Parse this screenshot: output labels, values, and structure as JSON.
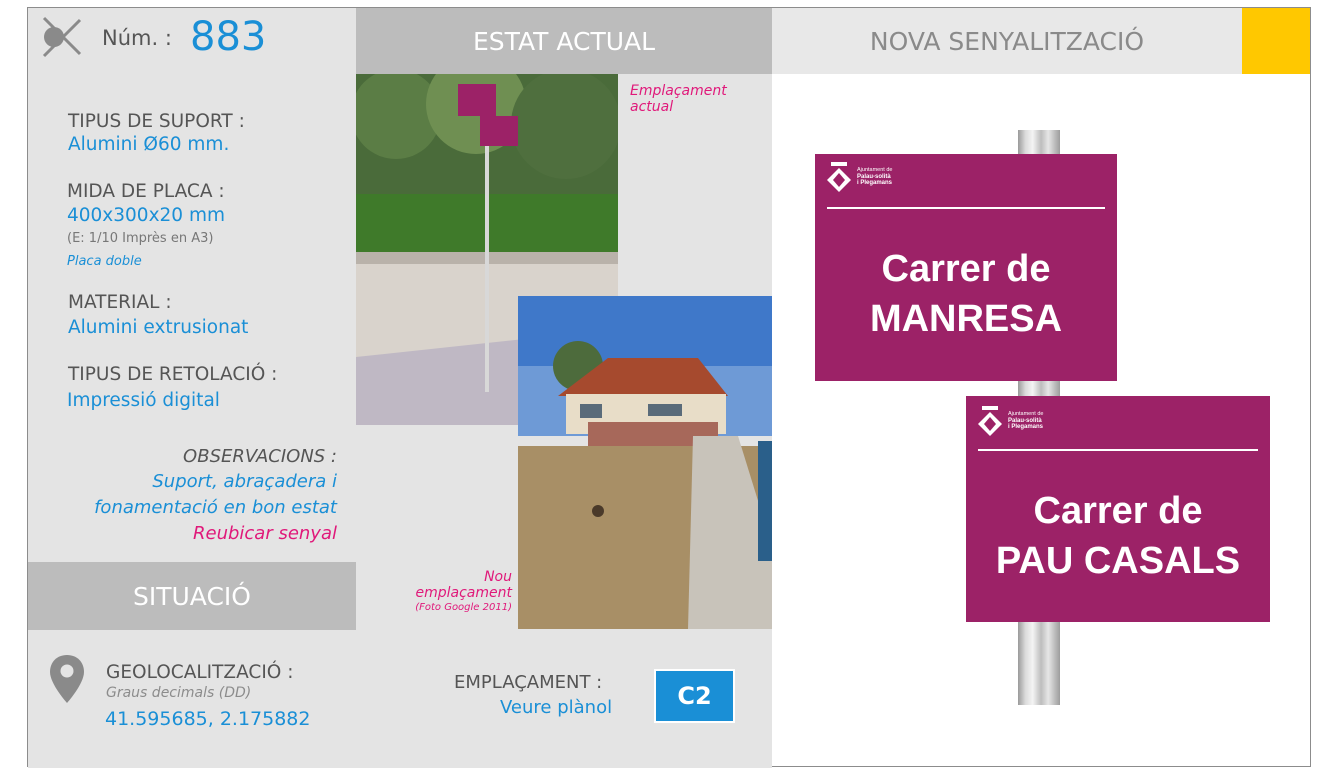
{
  "header": {
    "num_label": "Núm. :",
    "num_value": "883",
    "current_state": "ESTAT ACTUAL",
    "new_signage": "NOVA SENYALITZACIÓ",
    "accent_color": "#ffc800"
  },
  "specs": {
    "support_label": "TIPUS DE SUPORT :",
    "support_value": "Alumini Ø60 mm.",
    "size_label": "MIDA DE PLACA :",
    "size_value": "400x300x20 mm",
    "size_scale": "(E: 1/10 Imprès en A3)",
    "size_type": "Placa doble",
    "material_label": "MATERIAL :",
    "material_value": "Alumini extrusionat",
    "lettering_label": "TIPUS DE RETOLACIÓ :",
    "lettering_value": "Impressió digital"
  },
  "observations": {
    "label": "OBSERVACIONS :",
    "line1": "Suport, abraçadera i",
    "line2": "fonamentació en bon estat",
    "line3": "Reubicar senyal"
  },
  "situation": {
    "title": "SITUACIÓ",
    "geo_label": "GEOLOCALITZACIÓ :",
    "geo_format": "Graus decimals (DD)",
    "geo_value": "41.595685, 2.175882",
    "placement_label": "EMPLAÇAMENT :",
    "placement_link": "Veure plànol",
    "placement_code": "C2"
  },
  "photos": {
    "current_caption_1": "Emplaçament",
    "current_caption_2": "actual",
    "new_caption_1": "Nou",
    "new_caption_2": "emplaçament",
    "new_caption_3": "(Foto Google 2011)"
  },
  "signs": [
    {
      "logo_line1": "Ajuntament de",
      "logo_line2": "Palau-solità",
      "logo_line3": "i Plegamans",
      "line1": "Carrer de",
      "line2": "MANRESA"
    },
    {
      "logo_line1": "Ajuntament de",
      "logo_line2": "Palau-solità",
      "logo_line3": "i Plegamans",
      "line1": "Carrer de",
      "line2": "PAU CASALS"
    }
  ],
  "colors": {
    "sign_purple": "#9c2267",
    "link_blue": "#1a8fd6",
    "observation_pink": "#e0197a"
  },
  "icons": [
    "arrow-marker-icon",
    "map-pin-icon",
    "municipal-crest-icon"
  ]
}
